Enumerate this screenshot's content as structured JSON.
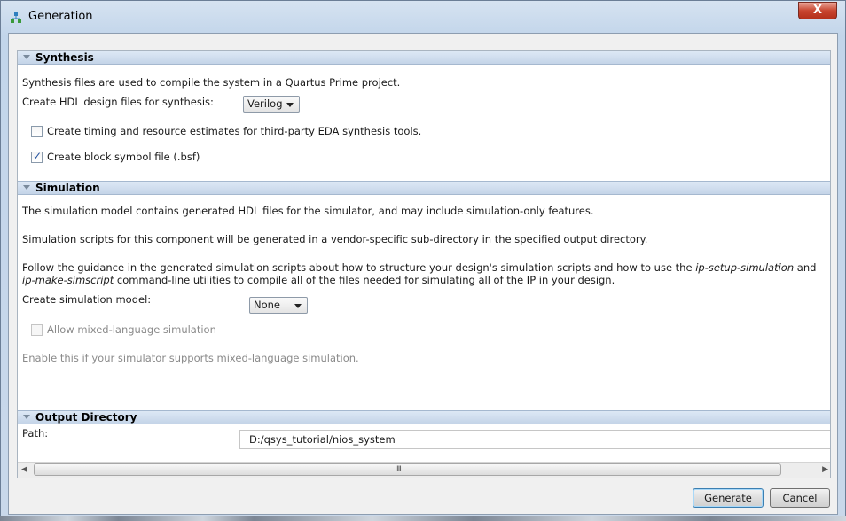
{
  "window": {
    "title": "Generation",
    "close_label": "X"
  },
  "synthesis": {
    "header": "Synthesis",
    "description": "Synthesis files are used to compile the system in a Quartus Prime project.",
    "hdl_label": "Create HDL design files for synthesis:",
    "hdl_value": "Verilog",
    "timing_label": "Create timing and resource estimates for third-party EDA synthesis tools.",
    "timing_checked": false,
    "bsf_label": "Create block symbol file (.bsf)",
    "bsf_checked": true
  },
  "simulation": {
    "header": "Simulation",
    "line1": "The simulation model contains generated HDL files for the simulator, and may include simulation-only features.",
    "line2": "Simulation scripts for this component will be generated in a vendor-specific sub-directory in the specified output directory.",
    "line3_a": "Follow the guidance in the generated simulation scripts about how to structure your design's simulation scripts and how to use the ",
    "line3_b": "ip-setup-simulation",
    "line3_c": " and",
    "line4_a": "ip-make-simscript",
    "line4_b": " command-line utilities to compile all of the files needed for simulating all of the IP in your design.",
    "model_label": "Create simulation model:",
    "model_value": "None",
    "mixed_label": "Allow mixed-language simulation",
    "mixed_checked": false,
    "mixed_hint": "Enable this if your simulator supports mixed-language simulation."
  },
  "output": {
    "header": "Output Directory",
    "path_label": "Path:",
    "path_value": "D:/qsys_tutorial/nios_system"
  },
  "scrollbar": {
    "left_arrow": "◀",
    "right_arrow": "▶",
    "grip": "III"
  },
  "buttons": {
    "generate": "Generate",
    "cancel": "Cancel"
  }
}
